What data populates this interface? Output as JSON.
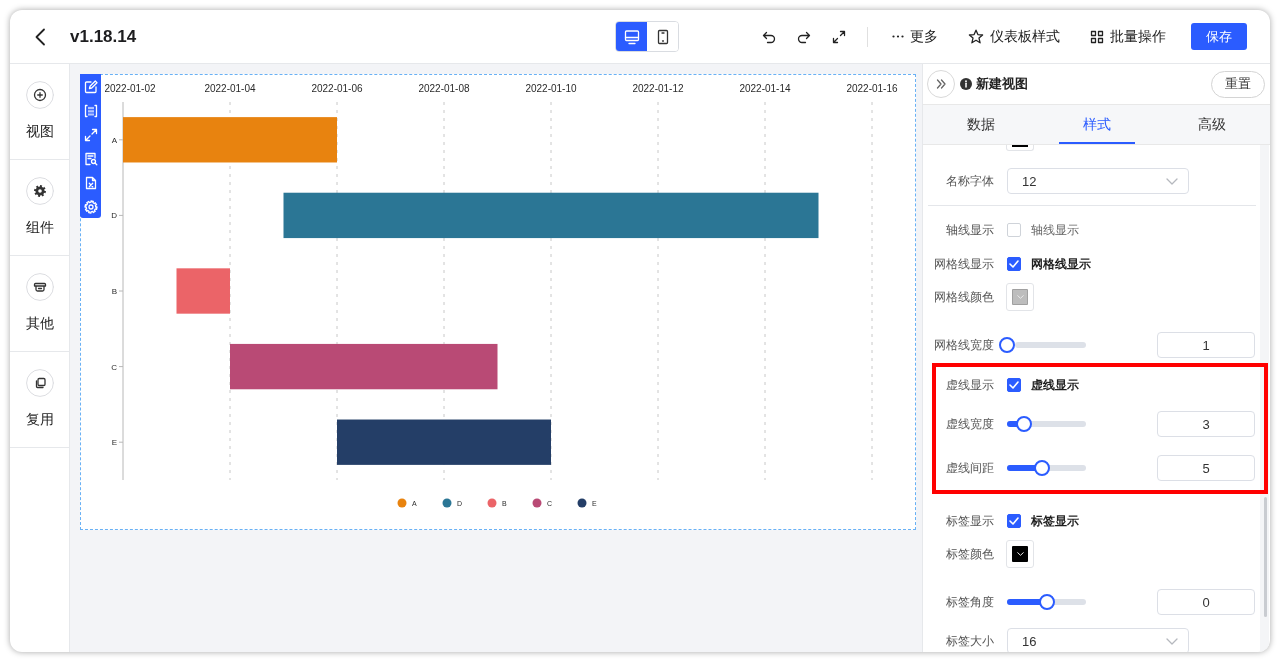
{
  "header": {
    "title": "v1.18.14",
    "device_modes": [
      {
        "kind": "desktop",
        "selected": true
      },
      {
        "kind": "mobile",
        "selected": false
      }
    ],
    "actions": [
      {
        "kind": "more",
        "label": "更多"
      },
      {
        "kind": "style",
        "label": "仪表板样式"
      },
      {
        "kind": "batch",
        "label": "批量操作"
      }
    ],
    "save_button": "保存"
  },
  "sidebar": {
    "items": [
      {
        "kind": "view",
        "label": "视图"
      },
      {
        "kind": "component",
        "label": "组件"
      },
      {
        "kind": "other",
        "label": "其他"
      },
      {
        "kind": "reuse",
        "label": "复用"
      }
    ]
  },
  "canvas": {
    "gantt_chart": {
      "date_labels": [
        "2022-01-02",
        "2022-01-04",
        "2022-01-06",
        "2022-01-08",
        "2022-01-10",
        "2022-01-12",
        "2022-01-14",
        "2022-01-16"
      ],
      "categories": [
        "A",
        "D",
        "B",
        "C",
        "E"
      ],
      "legend": [
        {
          "label": "A",
          "color": "#e8830f"
        },
        {
          "label": "D",
          "color": "#2b7695"
        },
        {
          "label": "B",
          "color": "#eb6468"
        },
        {
          "label": "C",
          "color": "#b94a75"
        },
        {
          "label": "E",
          "color": "#243e67"
        }
      ]
    }
  },
  "panel": {
    "title": "新建视图",
    "reset_button": "重置",
    "tabs": [
      {
        "label": "数据",
        "selected": false
      },
      {
        "label": "样式",
        "selected": true
      },
      {
        "label": "高级",
        "selected": false
      }
    ],
    "groups": [
      {
        "kind": "plain",
        "rows": [
          {
            "kind": "color-cut",
            "color": "#000000"
          },
          {
            "kind": "select",
            "label": "名称字体",
            "value": "12"
          },
          {
            "kind": "divider"
          },
          {
            "kind": "checkbox",
            "label": "轴线显示",
            "option": "轴线显示",
            "checked": false
          },
          {
            "kind": "checkbox",
            "label": "网格线显示",
            "option": "网格线显示",
            "checked": true
          },
          {
            "kind": "color",
            "label": "网格线颜色",
            "color": "#bdbdbd"
          },
          {
            "kind": "slider",
            "label": "网格线宽度",
            "level": 0,
            "value": "1"
          }
        ]
      },
      {
        "kind": "highlight",
        "rows": [
          {
            "kind": "checkbox",
            "label": "虚线显示",
            "option": "虚线显示",
            "checked": true
          },
          {
            "kind": "slider",
            "label": "虚线宽度",
            "level": 0.22,
            "value": "3"
          },
          {
            "kind": "slider",
            "label": "虚线间距",
            "level": 0.44,
            "value": "5"
          }
        ]
      },
      {
        "kind": "plain",
        "rows": [
          {
            "kind": "checkbox",
            "label": "标签显示",
            "option": "标签显示",
            "checked": true
          },
          {
            "kind": "color",
            "label": "标签颜色",
            "color": "#000000"
          },
          {
            "kind": "slider",
            "label": "标签角度",
            "level": 0.5,
            "value": "0"
          },
          {
            "kind": "select",
            "label": "标签大小",
            "value": "16"
          }
        ]
      }
    ]
  }
}
